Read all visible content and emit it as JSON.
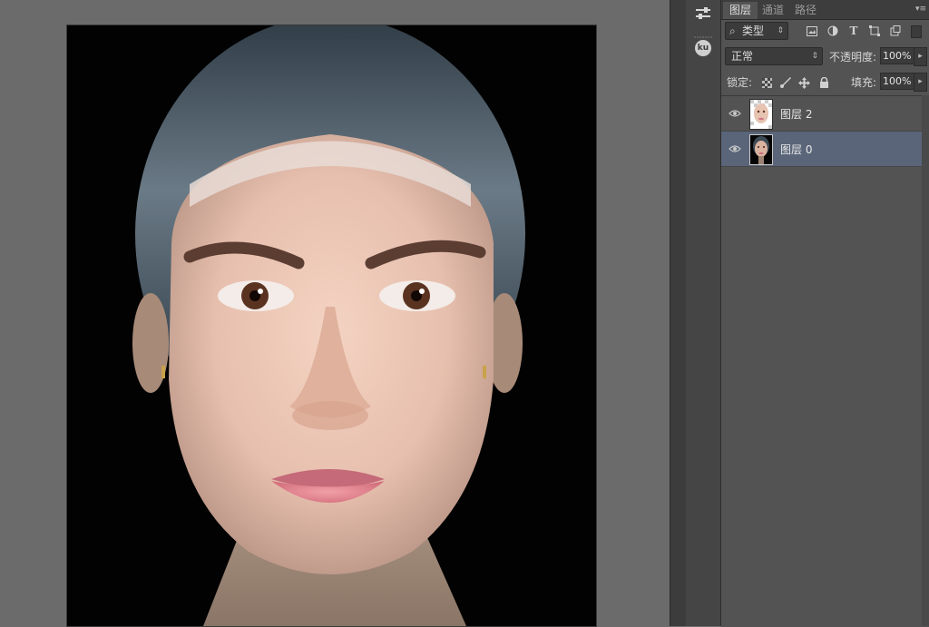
{
  "panel": {
    "tabs": [
      {
        "label": "图层",
        "active": true
      },
      {
        "label": "通道",
        "active": false
      },
      {
        "label": "路径",
        "active": false
      }
    ],
    "filter": {
      "label": "类型"
    },
    "blend_mode": "正常",
    "opacity_label": "不透明度:",
    "opacity_value": "100%",
    "lock_label": "锁定:",
    "fill_label": "填充:",
    "fill_value": "100%",
    "filter_icons": [
      "image-filter-icon",
      "adjustment-filter-icon",
      "type-filter-icon",
      "shape-filter-icon",
      "smart-object-filter-icon"
    ],
    "lock_icons": [
      "lock-transparent-icon",
      "lock-paint-icon",
      "lock-move-icon",
      "lock-all-icon"
    ]
  },
  "layers": [
    {
      "name": "图层 2",
      "visible": true,
      "selected": false
    },
    {
      "name": "图层 0",
      "visible": true,
      "selected": true
    }
  ],
  "strip": {
    "icons": [
      "adjustments-icon",
      "kuler-icon"
    ],
    "kuler_text": "ku"
  },
  "colors": {
    "panel_bg": "#535353",
    "selected_layer": "#5a6579",
    "workspace": "#6b6b6b"
  }
}
